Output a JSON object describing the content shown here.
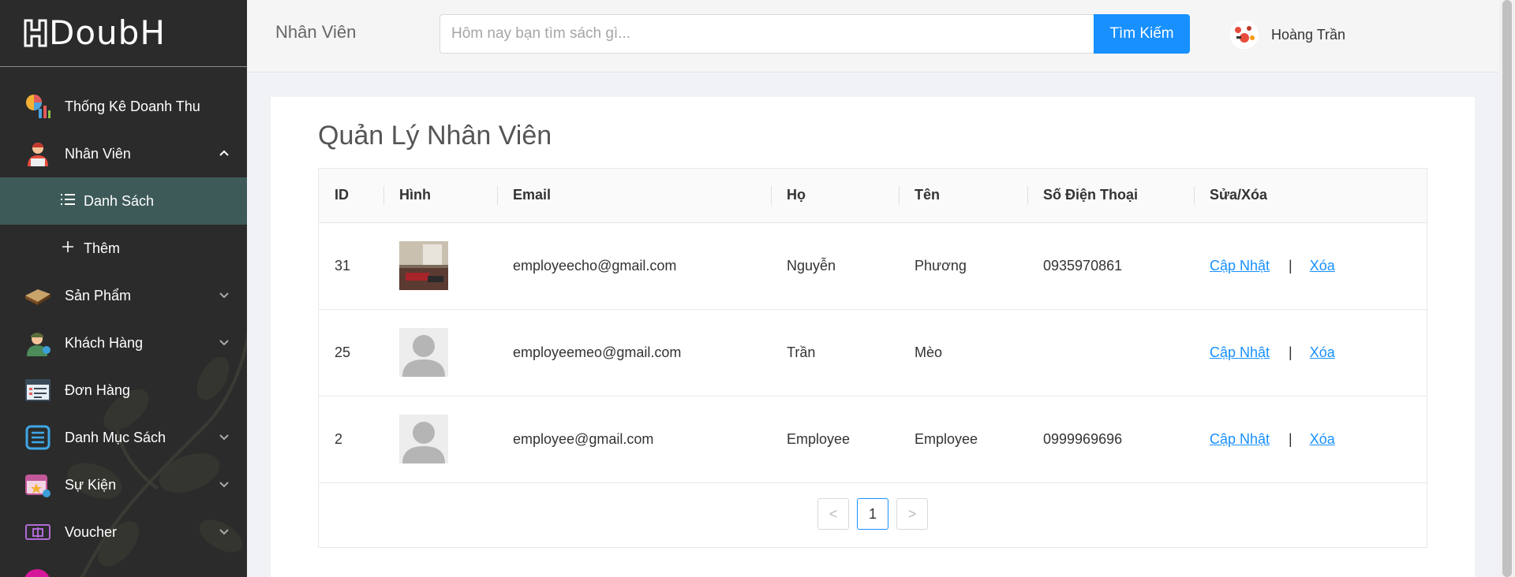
{
  "app": {
    "logo_text": "DoubH"
  },
  "sidebar": {
    "items": [
      {
        "label": "Thống Kê Doanh Thu",
        "icon": "chart-icon"
      },
      {
        "label": "Nhân Viên",
        "icon": "employee-icon",
        "expanded": true,
        "children": [
          {
            "label": "Danh Sách",
            "icon": "list-icon",
            "active": true
          },
          {
            "label": "Thêm",
            "icon": "plus-icon"
          }
        ]
      },
      {
        "label": "Sản Phẩm",
        "icon": "book-icon"
      },
      {
        "label": "Khách Hàng",
        "icon": "customer-icon"
      },
      {
        "label": "Đơn Hàng",
        "icon": "order-icon"
      },
      {
        "label": "Danh Mục Sách",
        "icon": "category-icon"
      },
      {
        "label": "Sự Kiện",
        "icon": "calendar-icon"
      },
      {
        "label": "Voucher",
        "icon": "voucher-icon"
      }
    ]
  },
  "header": {
    "title": "Nhân Viên",
    "search_placeholder": "Hôm nay bạn tìm sách gì...",
    "search_button": "Tìm Kiếm",
    "user_name": "Hoàng Trần"
  },
  "main": {
    "title": "Quản Lý Nhân Viên",
    "columns": [
      "ID",
      "Hình",
      "Email",
      "Họ",
      "Tên",
      "Số Điện Thoại",
      "Sửa/Xóa"
    ],
    "rows": [
      {
        "id": "31",
        "image": "photo",
        "email": "employeecho@gmail.com",
        "last_name": "Nguyễn",
        "first_name": "Phương",
        "phone": "0935970861"
      },
      {
        "id": "25",
        "image": "default-avatar",
        "email": "employeemeo@gmail.com",
        "last_name": "Trần",
        "first_name": "Mèo",
        "phone": ""
      },
      {
        "id": "2",
        "image": "default-avatar",
        "email": "employee@gmail.com",
        "last_name": "Employee",
        "first_name": "Employee",
        "phone": "0999969696"
      }
    ],
    "actions": {
      "edit": "Cập Nhật",
      "separator": "|",
      "delete": "Xóa"
    },
    "pagination": {
      "prev": "<",
      "current": "1",
      "next": ">"
    }
  },
  "colors": {
    "sidebar_bg": "#2b2b2b",
    "active_item": "#3d5a58",
    "accent": "#1890ff"
  }
}
